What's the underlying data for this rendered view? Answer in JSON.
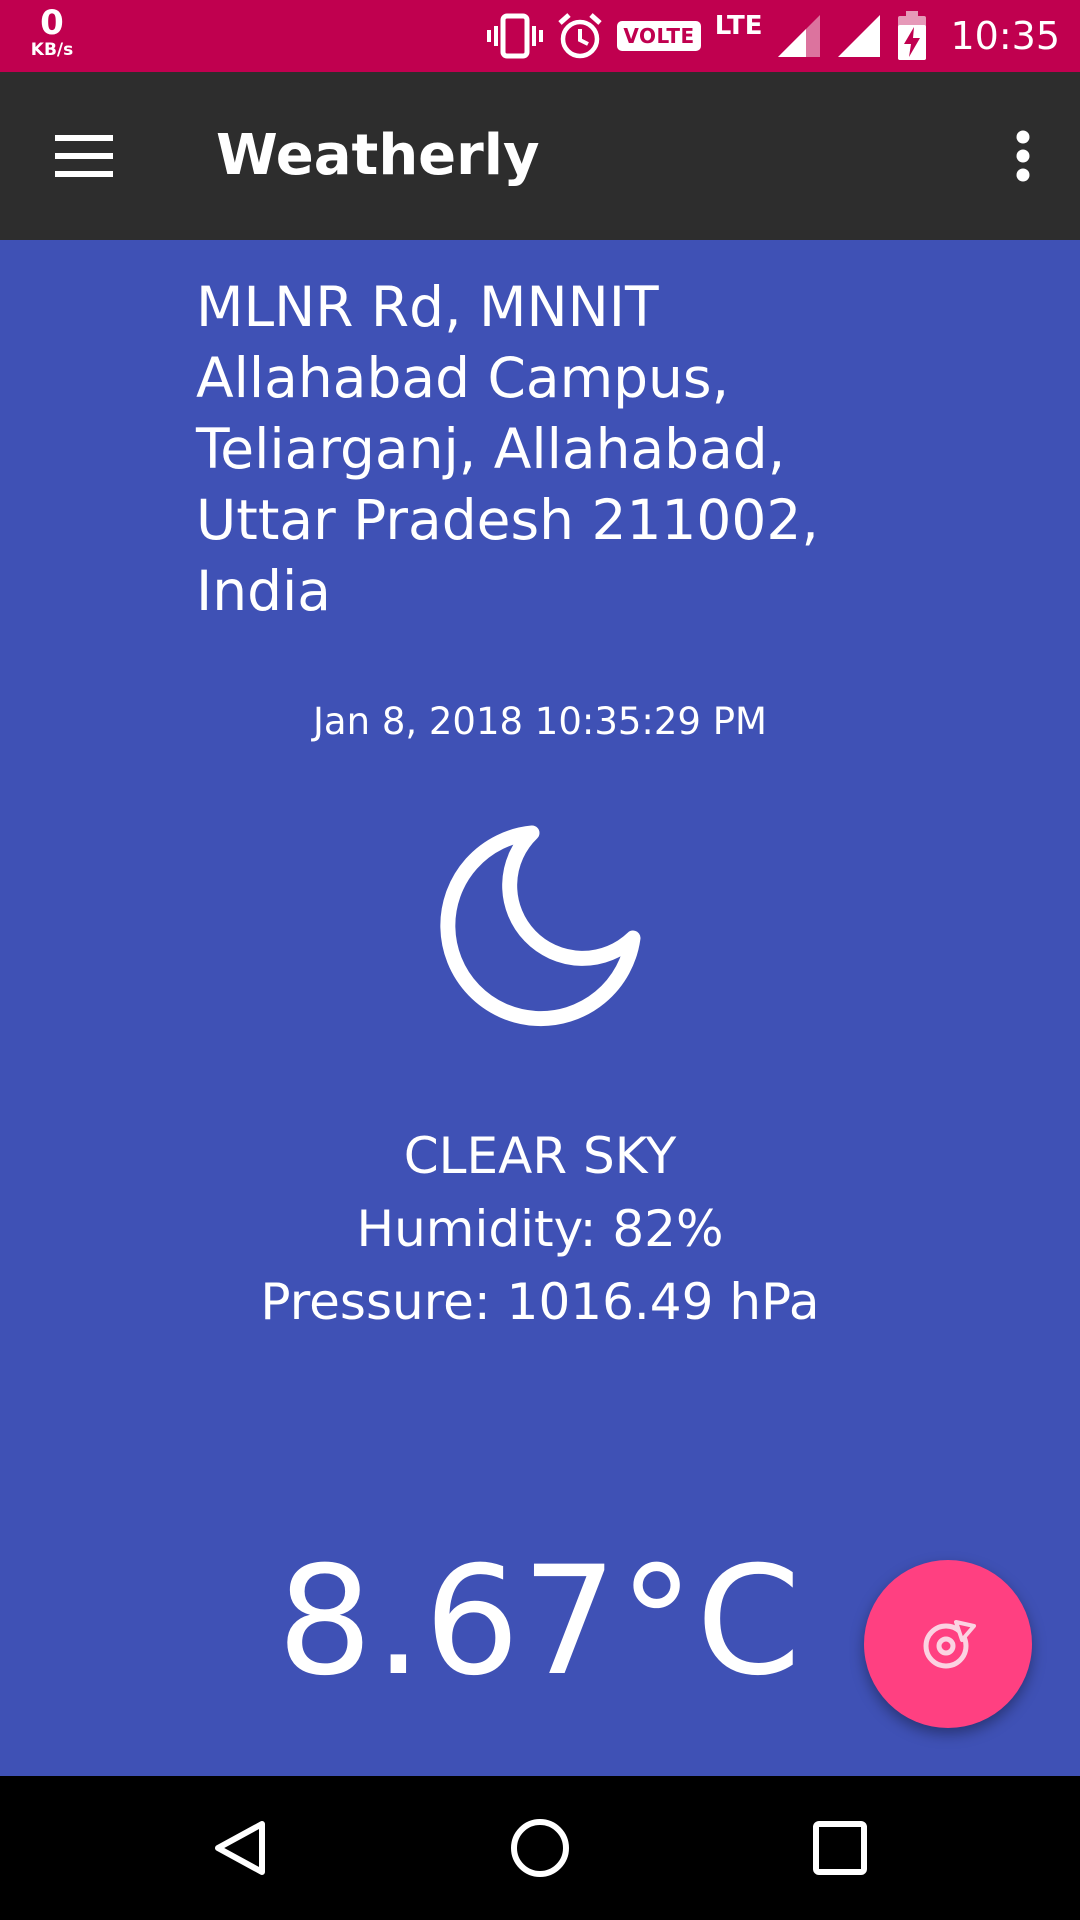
{
  "status_bar": {
    "net_speed_value": "0",
    "net_speed_unit": "KB/s",
    "volte_label": "VOLTE",
    "network_type": "LTE",
    "time": "10:35"
  },
  "app_bar": {
    "title": "Weatherly",
    "menu_icon": "hamburger-menu-icon",
    "overflow_icon": "more-vert-icon"
  },
  "weather": {
    "address": "MLNR Rd, MNNIT Allahabad Campus, Teliarganj, Allahabad, Uttar Pradesh 211002, India",
    "datetime": "Jan 8, 2018 10:35:29 PM",
    "condition_icon": "clear-sky-night-moon-icon",
    "condition": "CLEAR SKY",
    "humidity": "Humidity: 82%",
    "pressure": "Pressure: 1016.49 hPa",
    "temperature": "8.67°C"
  },
  "fab": {
    "icon": "refresh-icon"
  },
  "navigation": {
    "back_icon": "back-triangle-icon",
    "home_icon": "home-circle-icon",
    "recents_icon": "recents-square-icon"
  },
  "colors": {
    "status_bar": "#c0004f",
    "app_bar": "#2d2d2d",
    "background": "#3f51b5",
    "fab": "#ff4081",
    "text": "#ffffff"
  }
}
